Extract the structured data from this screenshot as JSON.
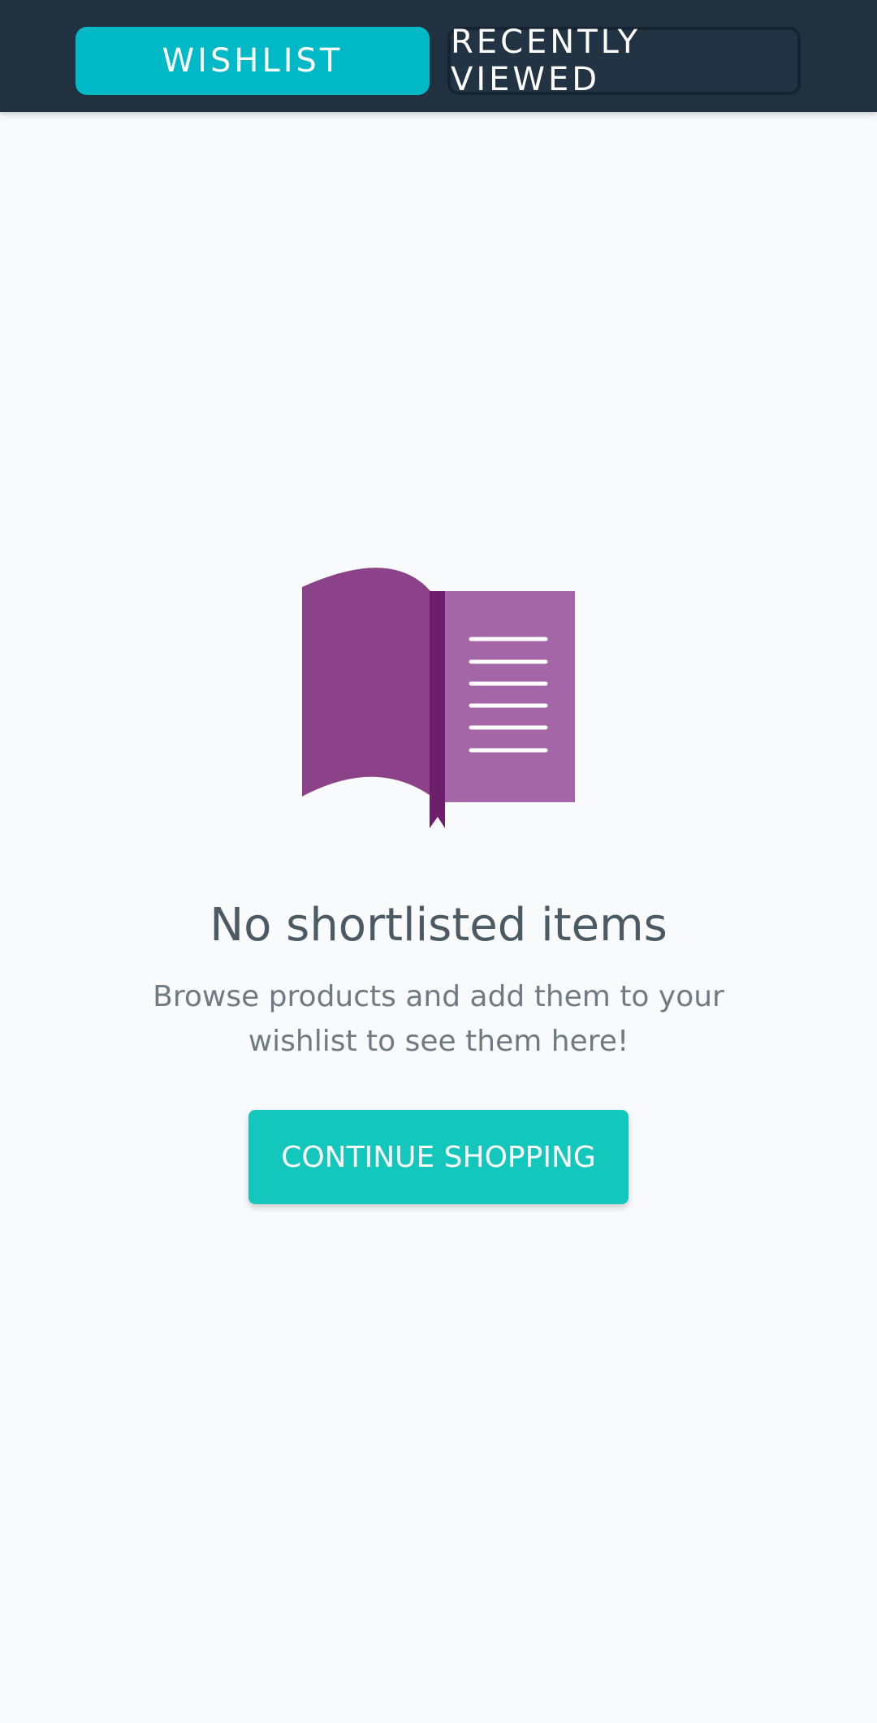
{
  "tabs": [
    {
      "label": "WISHLIST",
      "active": true
    },
    {
      "label": "RECENTLY VIEWED",
      "active": false
    }
  ],
  "empty_state": {
    "icon": "open-book-icon",
    "title": "No shortlisted items",
    "subtitle": "Browse products and add them to your wishlist to see them here!",
    "button_label": "CONTINUE SHOPPING"
  },
  "colors": {
    "header_bg": "#213140",
    "tab_active": "#00b9c7",
    "button_bg": "#14c7bd",
    "book_left": "#8b4289",
    "book_right": "#a566a8",
    "book_spine": "#6e1f6c"
  }
}
